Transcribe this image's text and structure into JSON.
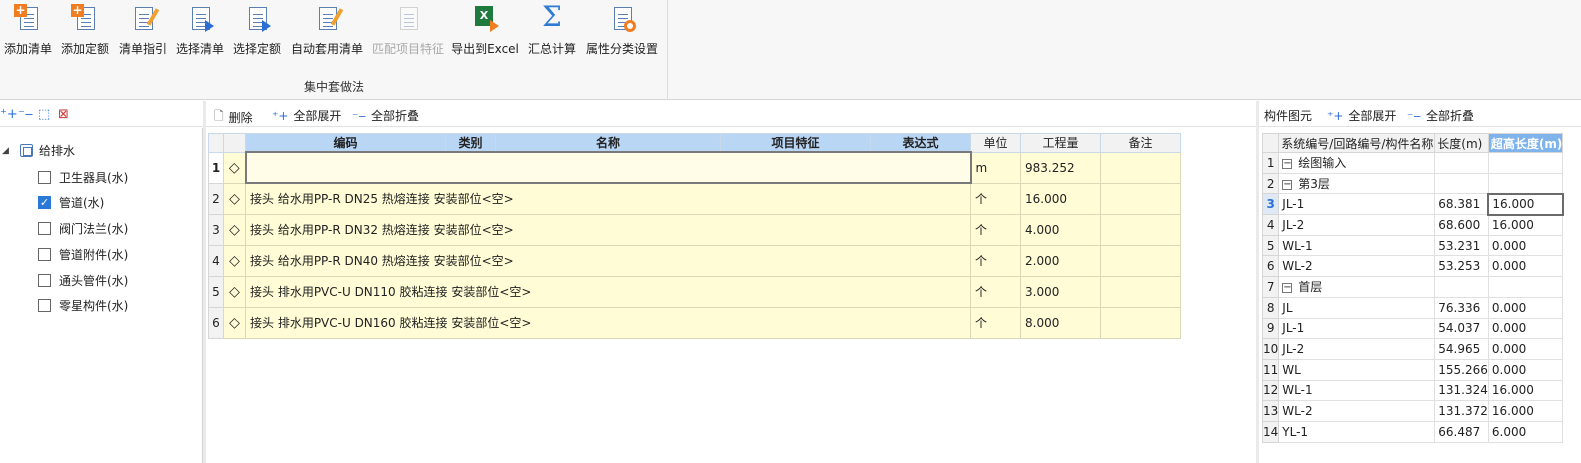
{
  "ribbon": {
    "buttons": [
      {
        "label": "添加清单",
        "icon": "add-list-icon",
        "enabled": true
      },
      {
        "label": "添加定额",
        "icon": "add-quota-icon",
        "enabled": true
      },
      {
        "label": "清单指引",
        "icon": "list-guide-icon",
        "enabled": true
      },
      {
        "label": "选择清单",
        "icon": "select-list-icon",
        "enabled": true
      },
      {
        "label": "选择定额",
        "icon": "select-quota-icon",
        "enabled": true
      },
      {
        "label": "自动套用清单",
        "icon": "auto-apply-icon",
        "enabled": true
      },
      {
        "label": "匹配项目特征",
        "icon": "match-feature-icon",
        "enabled": false
      },
      {
        "label": "导出到Excel",
        "icon": "excel-icon",
        "enabled": true
      },
      {
        "label": "汇总计算",
        "icon": "sigma-icon",
        "enabled": true
      },
      {
        "label": "属性分类设置",
        "icon": "settings-icon",
        "enabled": true
      }
    ],
    "group_label": "集中套做法"
  },
  "left_tree": {
    "root": "给排水",
    "items": [
      {
        "label": "卫生器具(水)",
        "checked": false
      },
      {
        "label": "管道(水)",
        "checked": true
      },
      {
        "label": "阀门法兰(水)",
        "checked": false
      },
      {
        "label": "管道附件(水)",
        "checked": false
      },
      {
        "label": "通头管件(水)",
        "checked": false
      },
      {
        "label": "零星构件(水)",
        "checked": false
      }
    ]
  },
  "mid_toolbar": {
    "delete_label": "删除",
    "expand_all_label": "全部展开",
    "collapse_all_label": "全部折叠"
  },
  "main_table": {
    "headers": [
      "编码",
      "类别",
      "名称",
      "项目特征",
      "表达式",
      "单位",
      "工程量",
      "备注"
    ],
    "rows": [
      {
        "n": "1",
        "name": "",
        "unit": "m",
        "qty": "983.252"
      },
      {
        "n": "2",
        "name": "接头 给水用PP-R DN25 热熔连接 安装部位<空>",
        "unit": "个",
        "qty": "16.000"
      },
      {
        "n": "3",
        "name": "接头 给水用PP-R DN32 热熔连接 安装部位<空>",
        "unit": "个",
        "qty": "4.000"
      },
      {
        "n": "4",
        "name": "接头 给水用PP-R DN40 热熔连接 安装部位<空>",
        "unit": "个",
        "qty": "2.000"
      },
      {
        "n": "5",
        "name": "接头 排水用PVC-U DN110 胶粘连接 安装部位<空>",
        "unit": "个",
        "qty": "3.000"
      },
      {
        "n": "6",
        "name": "接头 排水用PVC-U DN160 胶粘连接 安装部位<空>",
        "unit": "个",
        "qty": "8.000"
      }
    ]
  },
  "right_panel": {
    "title": "构件图元",
    "expand_all_label": "全部展开",
    "collapse_all_label": "全部折叠",
    "headers": [
      "系统编号/回路编号/构件名称",
      "长度(m)",
      "超高长度(m)"
    ],
    "rows": [
      {
        "n": "1",
        "name": "绘图输入",
        "len": "",
        "over": "",
        "level": 0
      },
      {
        "n": "2",
        "name": "第3层",
        "len": "",
        "over": "",
        "level": 1
      },
      {
        "n": "3",
        "name": "JL-1",
        "len": "68.381",
        "over": "16.000",
        "level": 2
      },
      {
        "n": "4",
        "name": "JL-2",
        "len": "68.600",
        "over": "16.000",
        "level": 2
      },
      {
        "n": "5",
        "name": "WL-1",
        "len": "53.231",
        "over": "0.000",
        "level": 2
      },
      {
        "n": "6",
        "name": "WL-2",
        "len": "53.253",
        "over": "0.000",
        "level": 2
      },
      {
        "n": "7",
        "name": "首层",
        "len": "",
        "over": "",
        "level": 1
      },
      {
        "n": "8",
        "name": "JL",
        "len": "76.336",
        "over": "0.000",
        "level": 2
      },
      {
        "n": "9",
        "name": "JL-1",
        "len": "54.037",
        "over": "0.000",
        "level": 2
      },
      {
        "n": "10",
        "name": "JL-2",
        "len": "54.965",
        "over": "0.000",
        "level": 2
      },
      {
        "n": "11",
        "name": "WL",
        "len": "155.266",
        "over": "0.000",
        "level": 2
      },
      {
        "n": "12",
        "name": "WL-1",
        "len": "131.324",
        "over": "16.000",
        "level": 2
      },
      {
        "n": "13",
        "name": "WL-2",
        "len": "131.372",
        "over": "16.000",
        "level": 2
      },
      {
        "n": "14",
        "name": "YL-1",
        "len": "66.487",
        "over": "6.000",
        "level": 2
      }
    ]
  }
}
